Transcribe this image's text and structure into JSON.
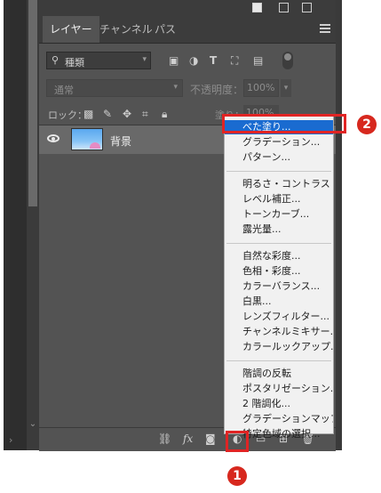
{
  "tabs": [
    {
      "label": "レイヤー",
      "active": true
    },
    {
      "label": "チャンネル",
      "active": false
    },
    {
      "label": "パス",
      "active": false
    }
  ],
  "filter": {
    "kind_label": "種類"
  },
  "blend": {
    "mode": "通常",
    "opacity_label": "不透明度：",
    "opacity_value": "100%"
  },
  "lock": {
    "label": "ロック：",
    "fill_label": "塗り：",
    "fill_value": "100%"
  },
  "layer": {
    "name": "背景"
  },
  "bottom": {
    "fx": "fx"
  },
  "menu": {
    "groups": [
      [
        "べた塗り...",
        "グラデーション...",
        "パターン..."
      ],
      [
        "明るさ・コントラスト...",
        "レベル補正...",
        "トーンカーブ...",
        "露光量..."
      ],
      [
        "自然な彩度...",
        "色相・彩度...",
        "カラーバランス...",
        "白黒...",
        "レンズフィルター...",
        "チャンネルミキサー...",
        "カラールックアップ..."
      ],
      [
        "階調の反転",
        "ポスタリゼーション...",
        "2 階調化...",
        "グラデーションマップ...",
        "特定色域の選択..."
      ]
    ],
    "highlighted": "べた塗り..."
  },
  "callouts": {
    "one": "1",
    "two": "2"
  },
  "colors": {
    "accent": "#1a6bd0",
    "callout": "#e02424",
    "panel": "#535353"
  }
}
